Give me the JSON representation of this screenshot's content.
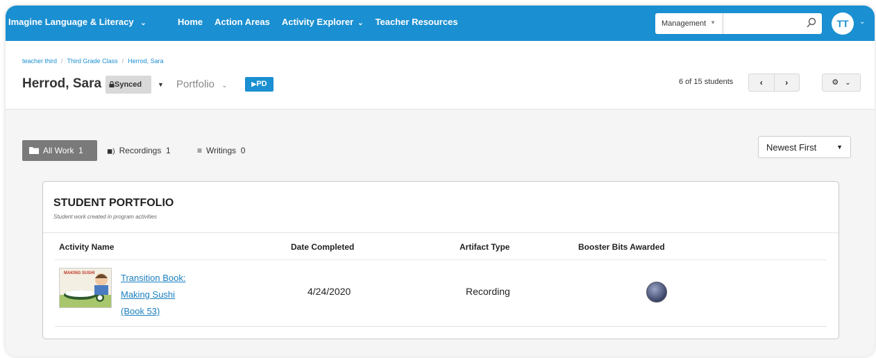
{
  "topnav": {
    "brand": "Imagine Language & Literacy",
    "links": [
      {
        "label": "Home"
      },
      {
        "label": "Action Areas"
      },
      {
        "label": "Activity Explorer"
      },
      {
        "label": "Teacher Resources"
      }
    ],
    "role_select": "Management",
    "search_placeholder": "",
    "avatar_initials": "TT"
  },
  "breadcrumb": [
    "teacher third",
    "Third Grade Class",
    "Herrod, Sara"
  ],
  "header": {
    "student_name": "Herrod, Sara",
    "synced_label": "Synced",
    "view_label": "Portfolio",
    "pd_label": "PD",
    "student_count": "6 of 15 students"
  },
  "filters": {
    "all_work": "All Work  1",
    "recordings": "Recordings  1",
    "writings": "Writings  0",
    "sort": "Newest First"
  },
  "portfolio": {
    "title": "STUDENT PORTFOLIO",
    "subtitle": "Student work created in program activities",
    "columns": [
      "Activity Name",
      "Date Completed",
      "Artifact Type",
      "Booster Bits Awarded"
    ],
    "rows": [
      {
        "thumbnail_caption": "MAKING SUSHI",
        "activity_line1": "Transition Book:",
        "activity_line2": "Making Sushi",
        "activity_line3": "(Book 53)",
        "date_completed": "4/24/2020",
        "artifact_type": "Recording"
      }
    ]
  },
  "colors": {
    "brand_blue": "#1a8fd1",
    "active_filter": "#7a7a7a"
  },
  "icons": [
    "chevron-down-icon",
    "search-icon",
    "lock-icon",
    "play-icon",
    "chevron-left-icon",
    "chevron-right-icon",
    "gear-icon",
    "folder-icon",
    "speaker-icon",
    "lines-icon",
    "booster-bit-icon"
  ]
}
